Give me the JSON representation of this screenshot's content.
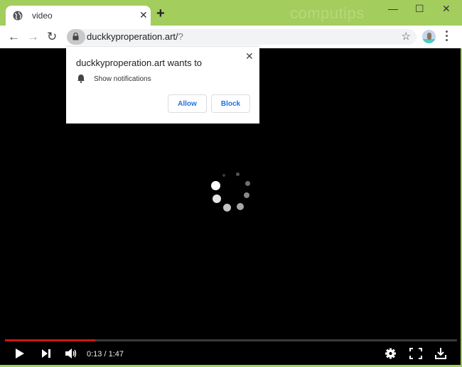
{
  "browser": {
    "tab_title": "video",
    "tab_icon": "globe-icon",
    "new_tab_label": "+",
    "watermark": "computips",
    "window_controls": {
      "minimize": "—",
      "maximize": "☐",
      "close": "✕"
    },
    "url_host": "duckkyproperation.art/",
    "url_rest": "?",
    "bookmark_icon": "☆",
    "nav": {
      "back": "←",
      "forward": "→",
      "reload": "↻"
    }
  },
  "permission_popup": {
    "heading": "duckkyproperation.art wants to",
    "permission": "Show notifications",
    "allow_label": "Allow",
    "block_label": "Block",
    "close_label": "✕"
  },
  "player": {
    "current_time": "0:13",
    "duration": "1:47",
    "time_display": "0:13 / 1:47",
    "progress_fraction": 0.2,
    "progress_color": "#cc1818",
    "state": "loading"
  },
  "colors": {
    "frame": "#a3cd5d",
    "accent": "#1a73e8"
  }
}
